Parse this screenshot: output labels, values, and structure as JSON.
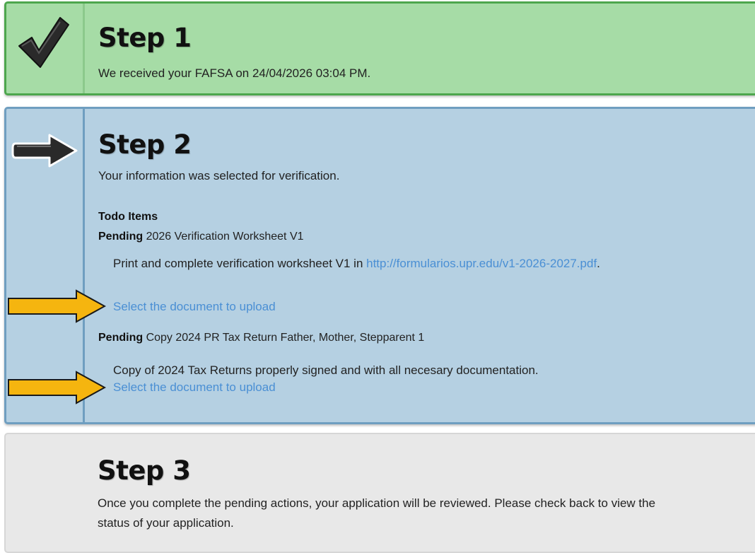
{
  "step1": {
    "title": "Step 1",
    "description": "We received your FAFSA on 24/04/2026 03:04 PM.",
    "status_icon": "checkmark-icon"
  },
  "step2": {
    "title": "Step 2",
    "description": "Your information was selected for verification.",
    "status_icon": "right-arrow-icon",
    "todo_heading": "Todo Items",
    "items": [
      {
        "status": "Pending",
        "name": "2026 Verification Worksheet V1",
        "text_before": "Print and complete verification worksheet V1 in ",
        "link_text": "http://formularios.upr.edu/v1-2026-2027.pdf",
        "text_after": ".",
        "upload_label": "Select the document to upload"
      },
      {
        "status": "Pending",
        "name": "Copy 2024 PR Tax Return Father, Mother, Stepparent 1",
        "text": "Copy of 2024 Tax Returns properly signed and with all necesary documentation.",
        "upload_label": "Select the document to upload"
      }
    ]
  },
  "step3": {
    "title": "Step 3",
    "description": "Once you complete the pending actions, your application will be reviewed. Please check back to view the status of your application."
  },
  "annotation": {
    "callout_icon": "yellow-arrow-icon",
    "callout_color": "#f5b50f"
  },
  "colors": {
    "step1_bg": "#a6dca6",
    "step1_border": "#4da64d",
    "step2_bg": "#b5d0e2",
    "step2_border": "#6f9ec0",
    "step3_bg": "#e8e8e8",
    "link": "#4a8fd4"
  }
}
